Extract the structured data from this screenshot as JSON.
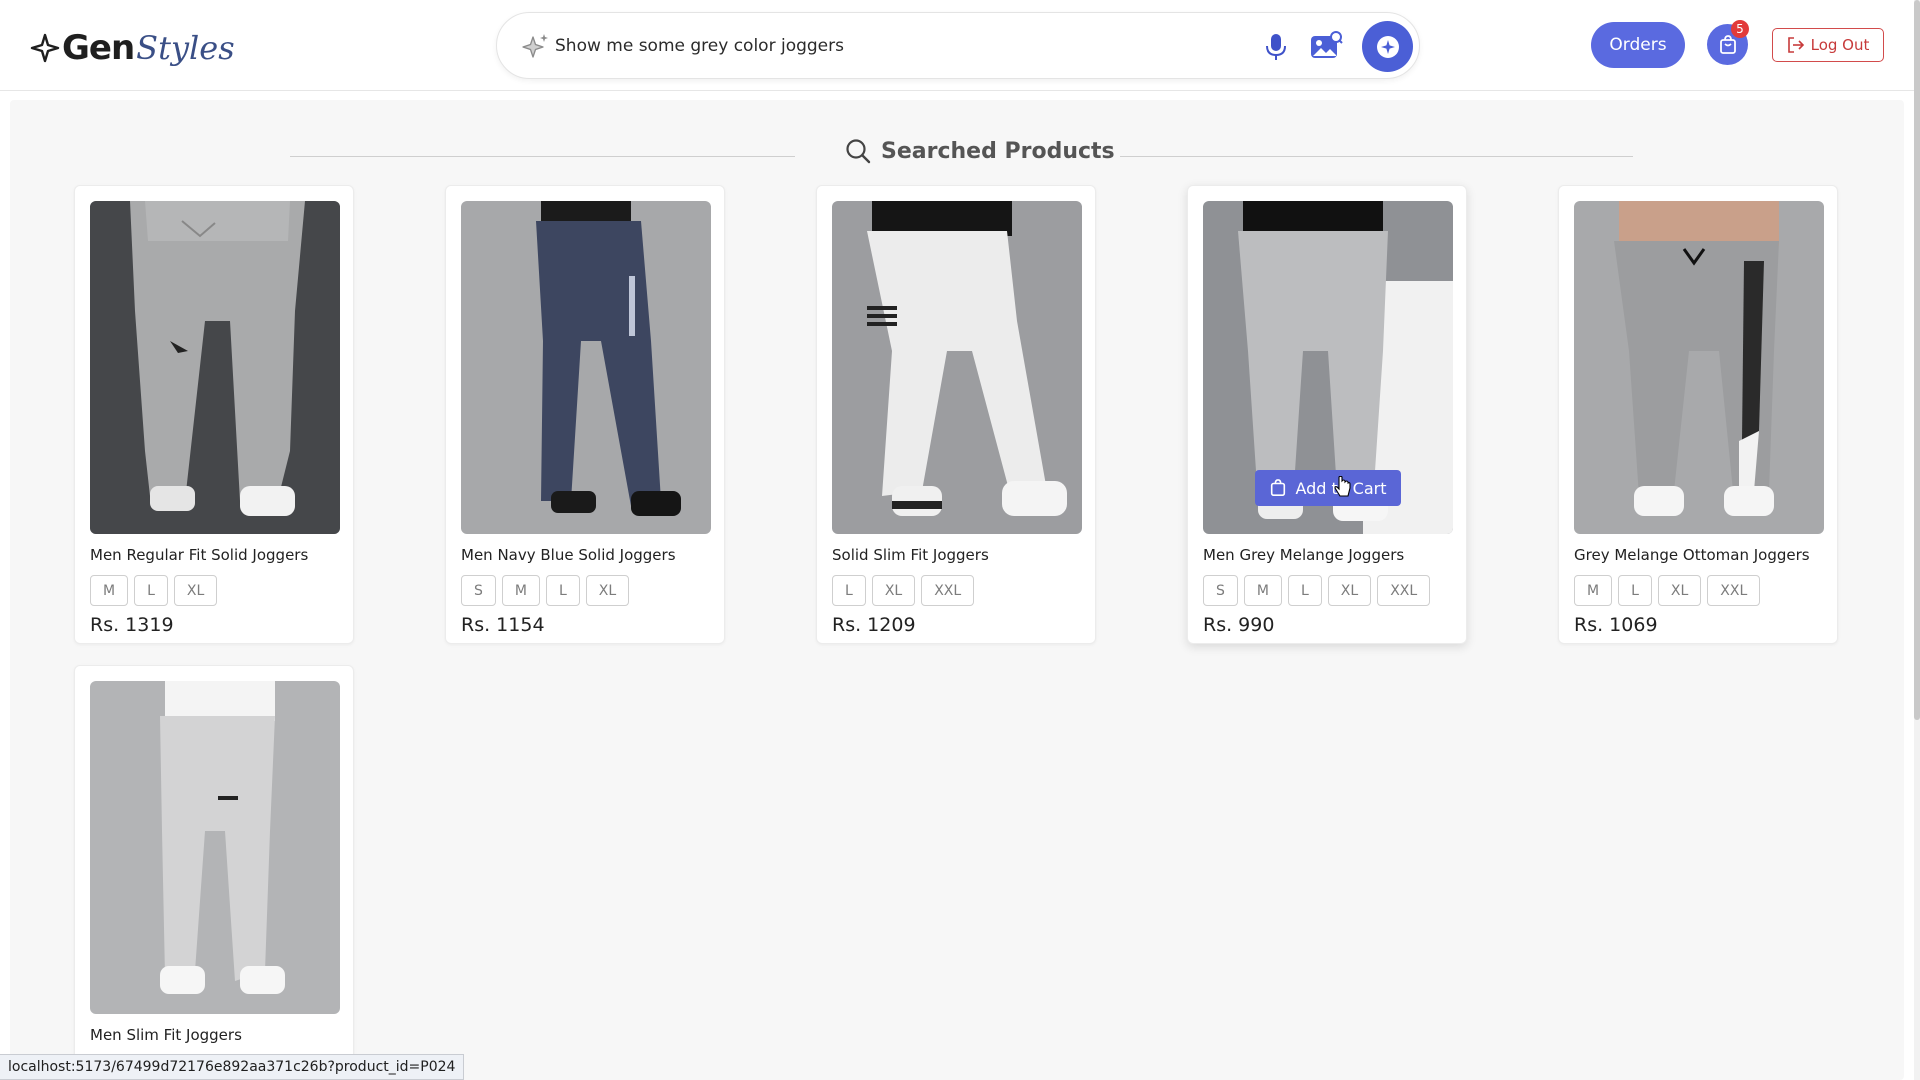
{
  "header": {
    "logo": {
      "brand_main": "Gen",
      "brand_script": "Styles"
    },
    "search": {
      "value": "Show me some grey color joggers",
      "placeholder": ""
    },
    "orders_label": "Orders",
    "cart_count": "5",
    "logout_label": "Log Out"
  },
  "section": {
    "title": "Searched Products"
  },
  "products": [
    {
      "name": "Men Regular Fit Solid Joggers",
      "sizes": [
        "M",
        "L",
        "XL"
      ],
      "price": "Rs. 1319"
    },
    {
      "name": "Men Navy Blue Solid Joggers",
      "sizes": [
        "S",
        "M",
        "L",
        "XL"
      ],
      "price": "Rs. 1154"
    },
    {
      "name": "Solid Slim Fit Joggers",
      "sizes": [
        "L",
        "XL",
        "XXL"
      ],
      "price": "Rs. 1209"
    },
    {
      "name": "Men Grey Melange Joggers",
      "sizes": [
        "S",
        "M",
        "L",
        "XL",
        "XXL"
      ],
      "price": "Rs. 990",
      "hover_button": "Add to Cart"
    },
    {
      "name": "Grey Melange Ottoman Joggers",
      "sizes": [
        "M",
        "L",
        "XL",
        "XXL"
      ],
      "price": "Rs. 1069"
    },
    {
      "name": "Men Slim Fit Joggers",
      "sizes": [],
      "price": ""
    }
  ],
  "status_url": "localhost:5173/67499d72176e892aa371c26b?product_id=P024",
  "colors": {
    "accent": "#5a6ae0",
    "logout": "#c73a3a",
    "badge": "#e23a3a"
  },
  "icons": {
    "search_sparkle": "sparkle-icon",
    "mic": "mic-icon",
    "image_search": "image-search-icon",
    "submit": "ai-search-icon",
    "cart": "shopping-bag-icon",
    "logout": "logout-icon",
    "section": "search-icon"
  }
}
